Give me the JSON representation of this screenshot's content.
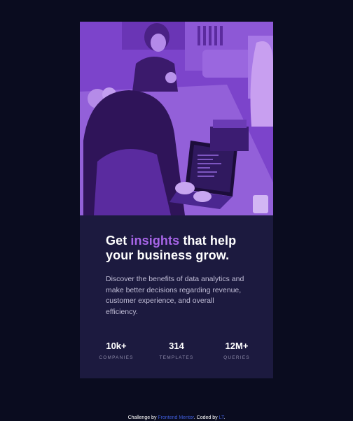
{
  "card": {
    "image_alt": "People working at a table with laptops",
    "headline_pre": "Get ",
    "headline_accent": "insights",
    "headline_post": " that help your business grow.",
    "description": "Discover the benefits of data analytics and make better decisions regarding revenue, customer experience, and overall efficiency.",
    "stats": [
      {
        "value": "10k+",
        "label": "COMPANIES"
      },
      {
        "value": "314",
        "label": "TEMPLATES"
      },
      {
        "value": "12M+",
        "label": "QUERIES"
      }
    ]
  },
  "footer": {
    "text_pre": "Challenge by ",
    "link_challenge": "Frontend Mentor",
    "text_mid": ". Coded by ",
    "link_author": "LT",
    "text_post": "."
  },
  "colors": {
    "background": "#0a0c1f",
    "card": "#1c1a3f",
    "accent": "#a865e8",
    "link": "#3f5cd8"
  }
}
